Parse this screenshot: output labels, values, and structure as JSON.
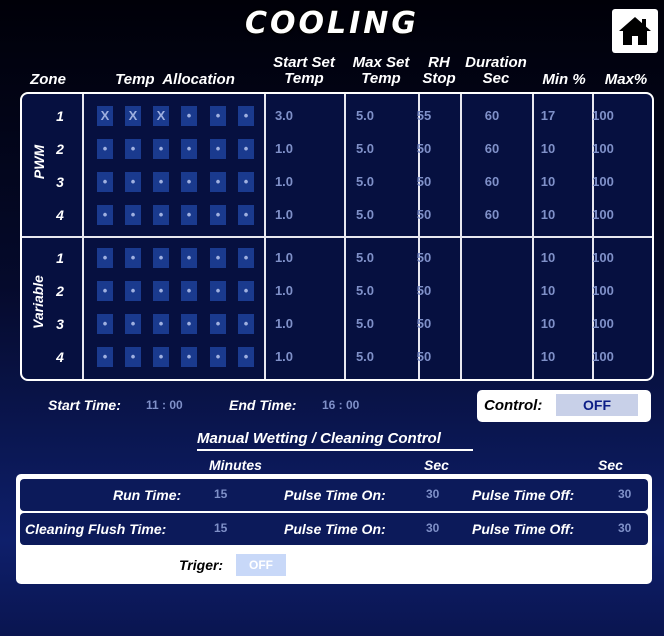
{
  "title": "COOLING",
  "headers": {
    "zone": "Zone",
    "temp_allocation": "Temp  Allocation",
    "start_set_temp": [
      "Start Set",
      "Temp"
    ],
    "max_set_temp": [
      "Max Set",
      "Temp"
    ],
    "rh_stop": [
      "RH",
      "Stop"
    ],
    "duration_sec": [
      "Duration",
      "Sec"
    ],
    "min_pct": "Min %",
    "max_pct": "Max%"
  },
  "pwm": {
    "label": "PWM",
    "rows": [
      {
        "zone": "1",
        "alloc": [
          "X",
          "X",
          "X",
          "•",
          "•",
          "•"
        ],
        "start": "3.0",
        "max": "5.0",
        "rh": "55",
        "duration": "60",
        "min": "17",
        "maxp": "100"
      },
      {
        "zone": "2",
        "alloc": [
          "•",
          "•",
          "•",
          "•",
          "•",
          "•"
        ],
        "start": "1.0",
        "max": "5.0",
        "rh": "50",
        "duration": "60",
        "min": "10",
        "maxp": "100"
      },
      {
        "zone": "3",
        "alloc": [
          "•",
          "•",
          "•",
          "•",
          "•",
          "•"
        ],
        "start": "1.0",
        "max": "5.0",
        "rh": "50",
        "duration": "60",
        "min": "10",
        "maxp": "100"
      },
      {
        "zone": "4",
        "alloc": [
          "•",
          "•",
          "•",
          "•",
          "•",
          "•"
        ],
        "start": "1.0",
        "max": "5.0",
        "rh": "50",
        "duration": "60",
        "min": "10",
        "maxp": "100"
      }
    ]
  },
  "variable": {
    "label": "Variable",
    "rows": [
      {
        "zone": "1",
        "alloc": [
          "•",
          "•",
          "•",
          "•",
          "•",
          "•"
        ],
        "start": "1.0",
        "max": "5.0",
        "rh": "50",
        "min": "10",
        "maxp": "100"
      },
      {
        "zone": "2",
        "alloc": [
          "•",
          "•",
          "•",
          "•",
          "•",
          "•"
        ],
        "start": "1.0",
        "max": "5.0",
        "rh": "50",
        "min": "10",
        "maxp": "100"
      },
      {
        "zone": "3",
        "alloc": [
          "•",
          "•",
          "•",
          "•",
          "•",
          "•"
        ],
        "start": "1.0",
        "max": "5.0",
        "rh": "50",
        "min": "10",
        "maxp": "100"
      },
      {
        "zone": "4",
        "alloc": [
          "•",
          "•",
          "•",
          "•",
          "•",
          "•"
        ],
        "start": "1.0",
        "max": "5.0",
        "rh": "50",
        "min": "10",
        "maxp": "100"
      }
    ]
  },
  "times": {
    "start_label": "Start Time:",
    "start_value": "11 : 00",
    "end_label": "End Time:",
    "end_value": "16 : 00"
  },
  "control": {
    "label": "Control:",
    "value": "OFF"
  },
  "manual": {
    "title": "Manual Wetting / Cleaning Control",
    "minutes_label": "Minutes",
    "sec_label_1": "Sec",
    "sec_label_2": "Sec",
    "run_time_label": "Run Time:",
    "run_time_value": "15",
    "pulse_on_label_1": "Pulse Time On:",
    "pulse_on_value_1": "30",
    "pulse_off_label_1": "Pulse Time Off:",
    "pulse_off_value_1": "30",
    "flush_label": "Cleaning Flush Time:",
    "flush_value": "15",
    "pulse_on_label_2": "Pulse Time On:",
    "pulse_on_value_2": "30",
    "pulse_off_label_2": "Pulse Time Off:",
    "pulse_off_value_2": "30",
    "trigger_label": "Triger:",
    "trigger_value": "OFF"
  },
  "icons": {
    "home": "home-icon"
  }
}
